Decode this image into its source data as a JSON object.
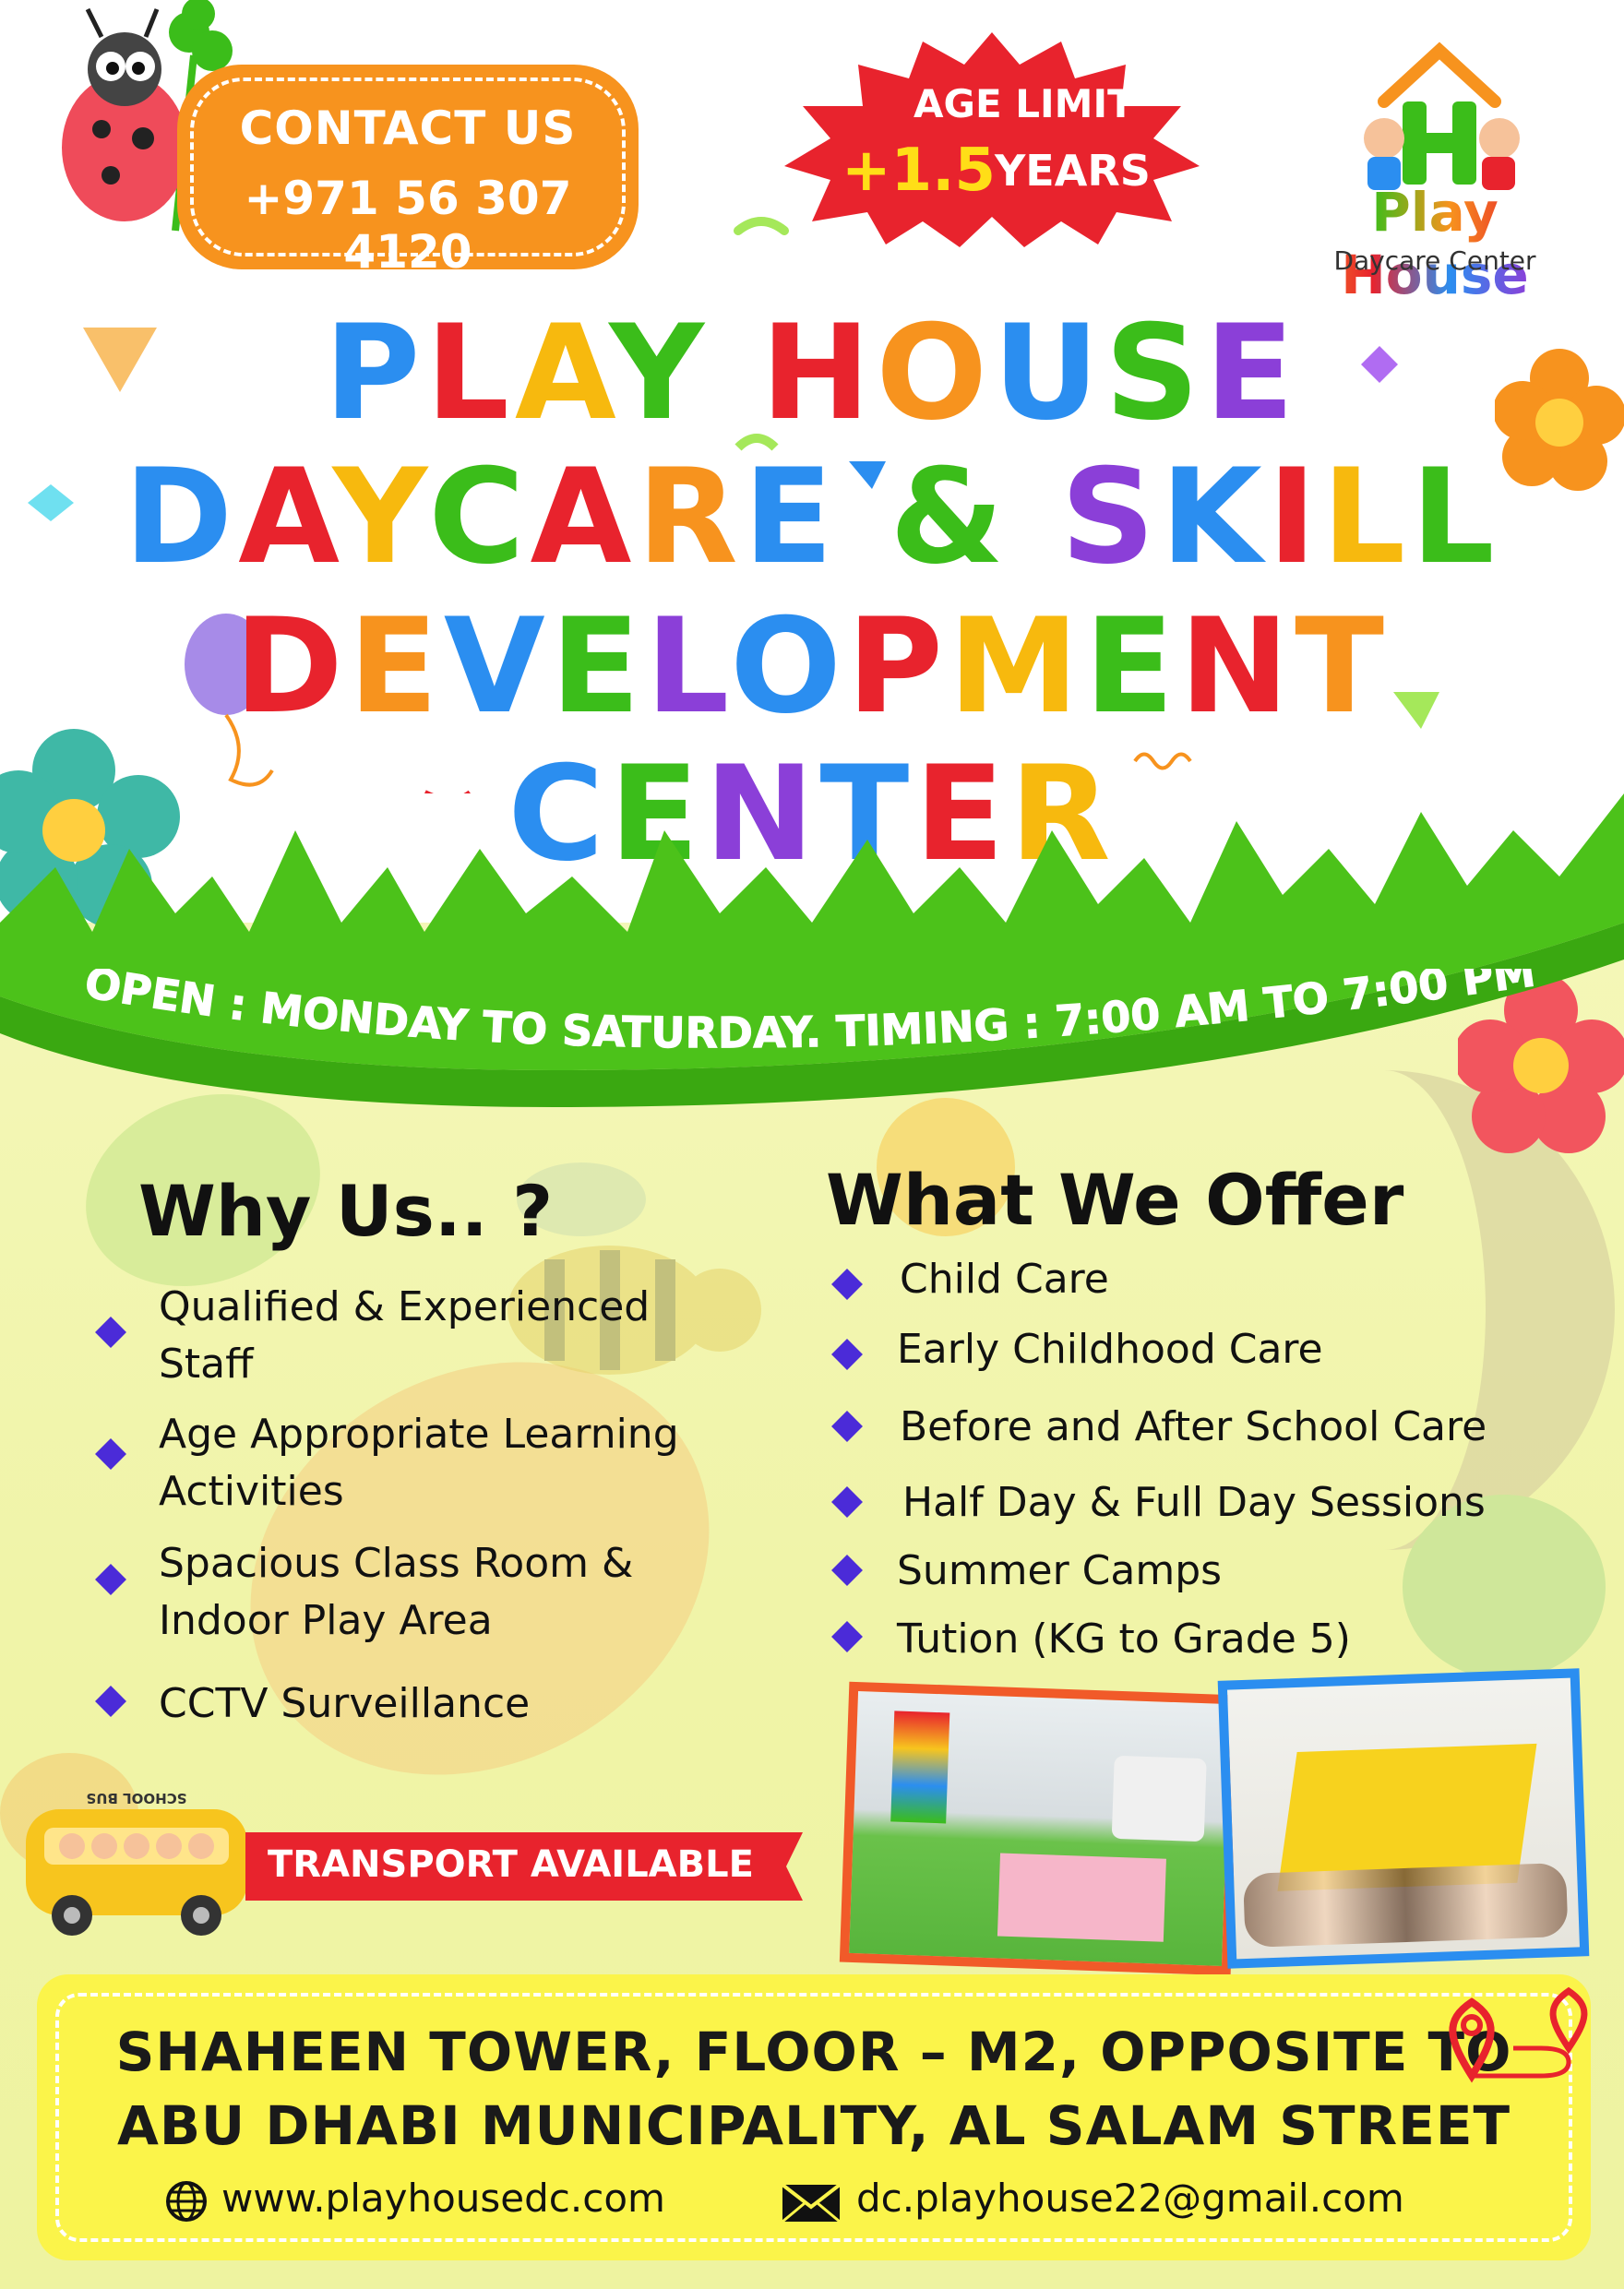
{
  "contact": {
    "title": "CONTACT US",
    "phone": "+971 56 307 4120"
  },
  "age_limit": {
    "line1": "AGE LIMIT",
    "number": "+1.5",
    "line2": "YEARS"
  },
  "logo": {
    "name": "Play House",
    "subtitle": "Daycare Center"
  },
  "title": {
    "line1": "PLAY HOUSE",
    "line2": "DAYCARE & SKILL",
    "line3": "DEVELOPMENT",
    "line4": "CENTER"
  },
  "open_banner": "OPEN : MONDAY TO SATURDAY. TIMING : 7:00 AM TO 7:00 PM",
  "why_us": {
    "heading": "Why Us.. ?",
    "items": [
      {
        "line1": "Qualified & Experienced",
        "line2": "Staff"
      },
      {
        "line1": "Age Appropriate Learning",
        "line2": "Activities"
      },
      {
        "line1": "Spacious Class Room &",
        "line2": "Indoor Play Area"
      },
      {
        "line1": "CCTV Surveillance",
        "line2": ""
      }
    ]
  },
  "what_we_offer": {
    "heading": "What We Offer",
    "items": [
      "Child Care",
      "Early Childhood Care",
      "Before and After School Care",
      "Half Day & Full Day Sessions",
      "Summer Camps",
      "Tution (KG to Grade 5)"
    ]
  },
  "school_bus_label": "SCHOOL BUS",
  "transport": "TRANSPORT AVAILABLE",
  "address": {
    "line1": "SHAHEEN TOWER, FLOOR – M2, OPPOSITE TO",
    "line2": "ABU DHABI MUNICIPALITY, AL SALAM STREET"
  },
  "website": "www.playhousedc.com",
  "email": "dc.playhouse22@gmail.com",
  "colors": {
    "orange": "#f7931e",
    "red": "#e8232d",
    "green": "#3bbd1a",
    "yellow": "#fbf44a",
    "blue": "#2b8ef0",
    "purple": "#4b2bd8",
    "title_letters": [
      "#2b8ef0",
      "#e8232d",
      "#f7b90e",
      "#3bbd1a",
      "#e8232d",
      "#f7931e",
      "#2b8ef0",
      "#3bbd1a",
      "#8b3fd8"
    ]
  },
  "icons": [
    "ladybug-icon",
    "clover-icon",
    "globe-icon",
    "mail-icon",
    "location-route-icon",
    "school-bus-icon",
    "flower-icon",
    "balloon-icon",
    "bee-icon"
  ]
}
